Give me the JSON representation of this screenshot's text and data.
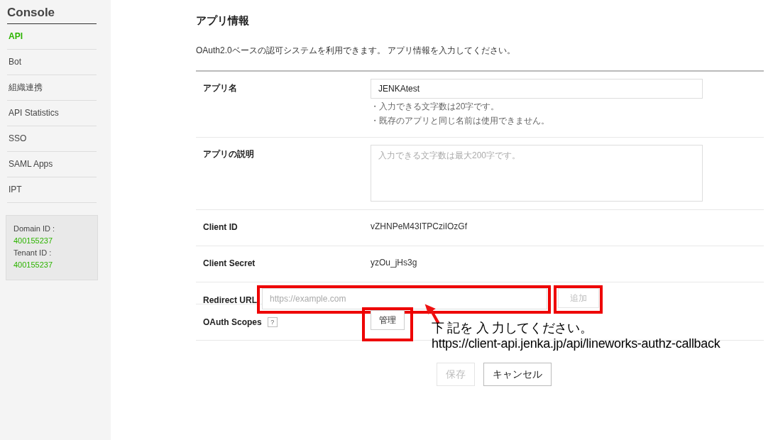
{
  "sidebar": {
    "title": "Console",
    "items": [
      {
        "label": "API",
        "selected": true
      },
      {
        "label": "Bot",
        "selected": false
      },
      {
        "label": "組織連携",
        "selected": false
      },
      {
        "label": "API Statistics",
        "selected": false
      },
      {
        "label": "SSO",
        "selected": false
      },
      {
        "label": "SAML Apps",
        "selected": false
      },
      {
        "label": "IPT",
        "selected": false
      }
    ],
    "info": [
      {
        "label": "Domain ID :",
        "value": "400155237"
      },
      {
        "label": "Tenant ID :",
        "value": "400155237"
      }
    ]
  },
  "section": {
    "title": "アプリ情報",
    "description": "OAuth2.0ベースの認可システムを利用できます。 アプリ情報を入力してください。"
  },
  "rows": [
    {
      "kind": "text",
      "label": "アプリ名",
      "value": "JENKAtest",
      "notes": [
        "・入力できる文字数は20字です。",
        "・既存のアプリと同じ名前は使用できません。"
      ]
    },
    {
      "kind": "textarea",
      "label": "アプリの説明",
      "placeholder": "入力できる文字数は最大200字です。"
    },
    {
      "kind": "value",
      "label": "Client ID",
      "value": "vZHNPeM43ITPCziIOzGf"
    },
    {
      "kind": "value",
      "label": "Client Secret",
      "value": "yzOu_jHs3g"
    },
    {
      "kind": "url",
      "label": "Redirect URL",
      "placeholder": "https://example.com",
      "button": {
        "label": "追加",
        "disabled": true
      },
      "highlighted": true
    },
    {
      "kind": "scopes",
      "label": "OAuth Scopes",
      "help": "?",
      "button": {
        "label": "管理",
        "disabled": false
      },
      "highlighted": true
    }
  ],
  "buttons": [
    {
      "kind": "save",
      "label": "保存",
      "disabled": true
    },
    {
      "kind": "cancel",
      "label": "キャンセル",
      "disabled": false
    }
  ],
  "annotation": {
    "lines": [
      "下 記を 入 力してください。",
      "https://client-api.jenka.jp/api/lineworks-authz-callback"
    ]
  }
}
